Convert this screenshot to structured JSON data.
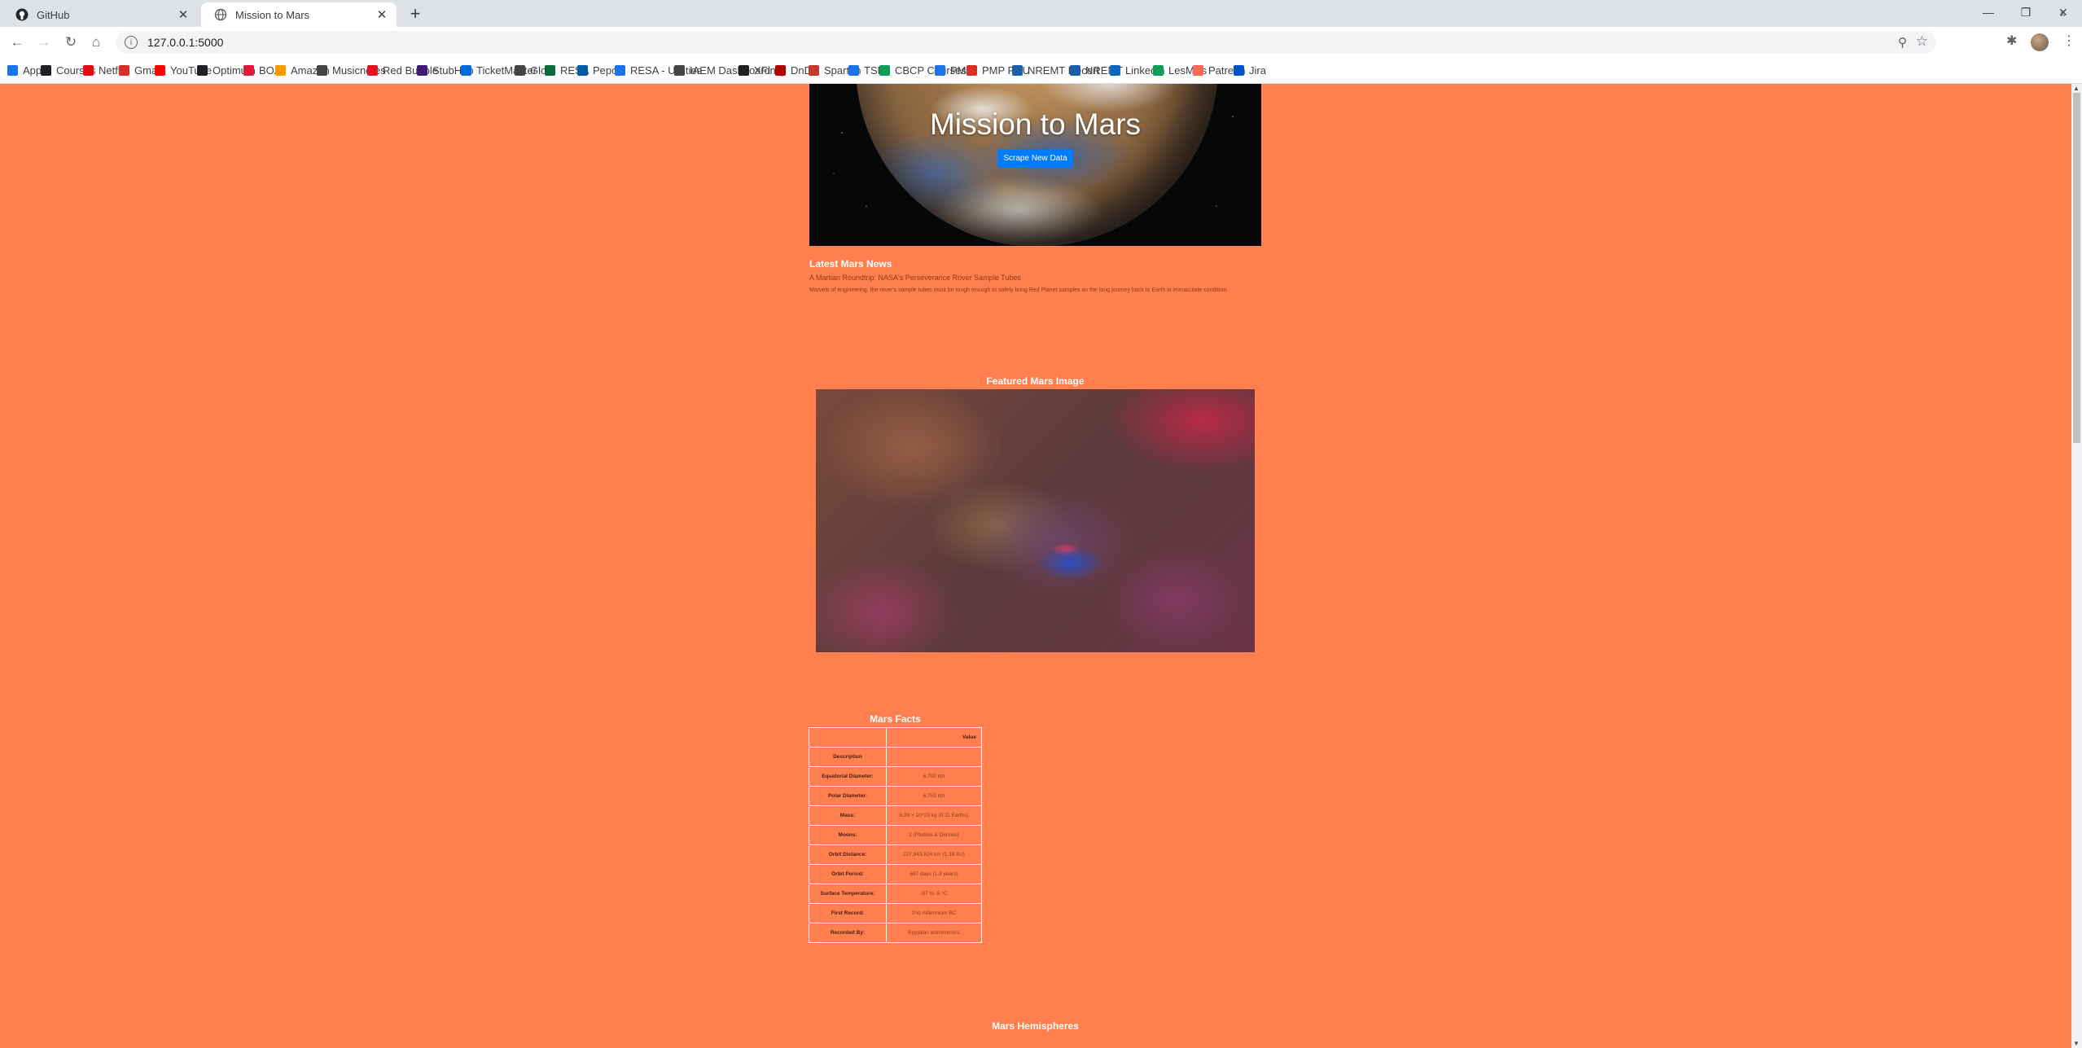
{
  "browser": {
    "tabs": [
      {
        "title": "GitHub",
        "icon": "github-icon"
      },
      {
        "title": "Mission to Mars",
        "icon": "globe-icon"
      }
    ],
    "new_tab": "+",
    "url": "127.0.0.1:5000",
    "bookmarks": [
      {
        "label": "Apps",
        "icon": "apps-grid-icon",
        "color": "#1a73e8"
      },
      {
        "label": "Courses",
        "icon": "courses-icon",
        "color": "#202124"
      },
      {
        "label": "Netflix",
        "icon": "netflix-icon",
        "color": "#e50914"
      },
      {
        "label": "Gmail",
        "icon": "gmail-icon",
        "color": "#d93025"
      },
      {
        "label": "YouTube",
        "icon": "youtube-icon",
        "color": "#ff0000"
      },
      {
        "label": "Optimum",
        "icon": "optimum-icon",
        "color": "#202124"
      },
      {
        "label": "BOA",
        "icon": "boa-icon",
        "color": "#e31837"
      },
      {
        "label": "Amazon",
        "icon": "amazon-icon",
        "color": "#ff9900"
      },
      {
        "label": "Musicnotes",
        "icon": "musicnotes-icon",
        "color": "#444444"
      },
      {
        "label": "Red Bubble",
        "icon": "redbubble-icon",
        "color": "#e41321"
      },
      {
        "label": "StubHub",
        "icon": "stubhub-icon",
        "color": "#3f1d74"
      },
      {
        "label": "TicketMaster",
        "icon": "ticketmaster-icon",
        "color": "#026cdf"
      },
      {
        "label": "Glo",
        "icon": "glo-icon",
        "color": "#444444"
      },
      {
        "label": "RESA",
        "icon": "resa-icon",
        "color": "#0a6b3a"
      },
      {
        "label": "Pepco",
        "icon": "pepco-icon",
        "color": "#005ca9"
      },
      {
        "label": "RESA - Utilities",
        "icon": "house-icon",
        "color": "#1a73e8"
      },
      {
        "label": "IAEM Dashboard",
        "icon": "iaem-icon",
        "color": "#444444"
      },
      {
        "label": "XFinity",
        "icon": "xfinity-icon",
        "color": "#202124"
      },
      {
        "label": "DnD",
        "icon": "dnd-icon",
        "color": "#b00000"
      },
      {
        "label": "Spartan",
        "icon": "spartan-icon",
        "color": "#c0392b"
      },
      {
        "label": "TSP",
        "icon": "tsp-icon",
        "color": "#1a73e8"
      },
      {
        "label": "CBCP Courses",
        "icon": "cbcp-icon",
        "color": "#0f9d58"
      },
      {
        "label": "PMI",
        "icon": "pmi-icon",
        "color": "#1a73e8"
      },
      {
        "label": "PMP PDU",
        "icon": "pmp-icon",
        "color": "#d93025"
      },
      {
        "label": "NREMT Recert",
        "icon": "nremt-recert-icon",
        "color": "#1a5fa8"
      },
      {
        "label": "NREMT",
        "icon": "nremt-icon",
        "color": "#1a5fa8"
      },
      {
        "label": "Linkedin",
        "icon": "linkedin-icon",
        "color": "#0a66c2"
      },
      {
        "label": "LesMills",
        "icon": "lesmills-icon",
        "color": "#0f9d58"
      },
      {
        "label": "Patreon",
        "icon": "patreon-icon",
        "color": "#f96854"
      },
      {
        "label": "Jira",
        "icon": "jira-icon",
        "color": "#0052cc"
      }
    ],
    "bookmarks_more": "»"
  },
  "page": {
    "background": "#ff7f4f",
    "title": "Mission to Mars",
    "scrape_button": "Scrape New Data",
    "news": {
      "heading": "Latest Mars News",
      "title": "A Martian Roundtrip: NASA's Perseverance Rover Sample Tubes",
      "teaser": "Marvels of engineering, the rover's sample tubes must be tough enough to safely bring Red Planet samples on the long journey back to Earth in immaculate condition."
    },
    "featured_image_heading": "Featured Mars Image",
    "facts": {
      "heading": "Mars Facts",
      "column_header": "Value",
      "index_header": "Description",
      "rows": [
        {
          "label": "Equatorial Diameter:",
          "value": "6,792 km"
        },
        {
          "label": "Polar Diameter:",
          "value": "6,752 km"
        },
        {
          "label": "Mass:",
          "value": "6.39 × 10^23 kg (0.11 Earths)"
        },
        {
          "label": "Moons:",
          "value": "2 (Phobos & Deimos)"
        },
        {
          "label": "Orbit Distance:",
          "value": "227,943,824 km (1.38 AU)"
        },
        {
          "label": "Orbit Period:",
          "value": "687 days (1.9 years)"
        },
        {
          "label": "Surface Temperature:",
          "value": "-87 to -5 °C"
        },
        {
          "label": "First Record:",
          "value": "2nd millennium BC"
        },
        {
          "label": "Recorded By:",
          "value": "Egyptian astronomers"
        }
      ]
    },
    "hemispheres_heading": "Mars Hemispheres"
  }
}
